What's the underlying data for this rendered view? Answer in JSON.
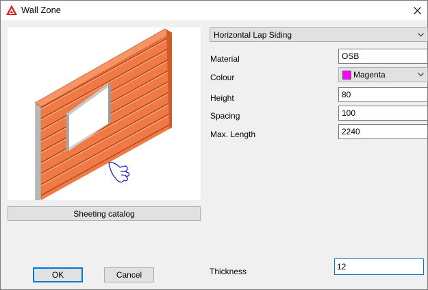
{
  "window": {
    "title": "Wall Zone"
  },
  "icons": {
    "app": "app-logo-icon",
    "close": "close-icon",
    "chevron": "chevron-down-icon",
    "hand": "pointing-hand-icon"
  },
  "colors": {
    "accent": "#0078d7",
    "siding": "#f07a45",
    "colour_swatch": "#ff00ff"
  },
  "preview": {
    "catalog_button": "Sheeting catalog"
  },
  "form": {
    "type_select": "Horizontal Lap Siding",
    "material_label": "Material",
    "material_value": "OSB",
    "colour_label": "Colour",
    "colour_value": "Magenta",
    "height_label": "Height",
    "height_value": "80",
    "spacing_label": "Spacing",
    "spacing_value": "100",
    "maxlength_label": "Max. Length",
    "maxlength_value": "2240",
    "thickness_label": "Thickness",
    "thickness_value": "12"
  },
  "buttons": {
    "ok": "OK",
    "cancel": "Cancel"
  }
}
